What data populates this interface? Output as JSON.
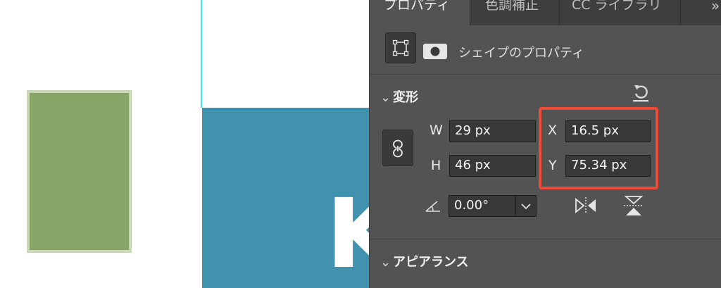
{
  "canvas": {
    "green_rect_color": "#88a466",
    "artboard_color": "#4092ae",
    "guide_color": "#3fe6ef",
    "big_glyph": "K"
  },
  "panel": {
    "tabs": [
      {
        "label": "プロパティ",
        "active": true
      },
      {
        "label": "色調補正",
        "active": false
      },
      {
        "label": "CC ライブラリ",
        "active": false
      }
    ],
    "more_label": "»",
    "shape_title": "シェイプのプロパティ",
    "transform": {
      "title": "変形",
      "w_label": "W",
      "w_value": "29 px",
      "h_label": "H",
      "h_value": "46 px",
      "x_label": "X",
      "x_value": "16.5 px",
      "y_label": "Y",
      "y_value": "75.34 px",
      "angle_value": "0.00°"
    },
    "appearance": {
      "title": "アピアランス"
    },
    "highlight_color": "#f04b37"
  }
}
